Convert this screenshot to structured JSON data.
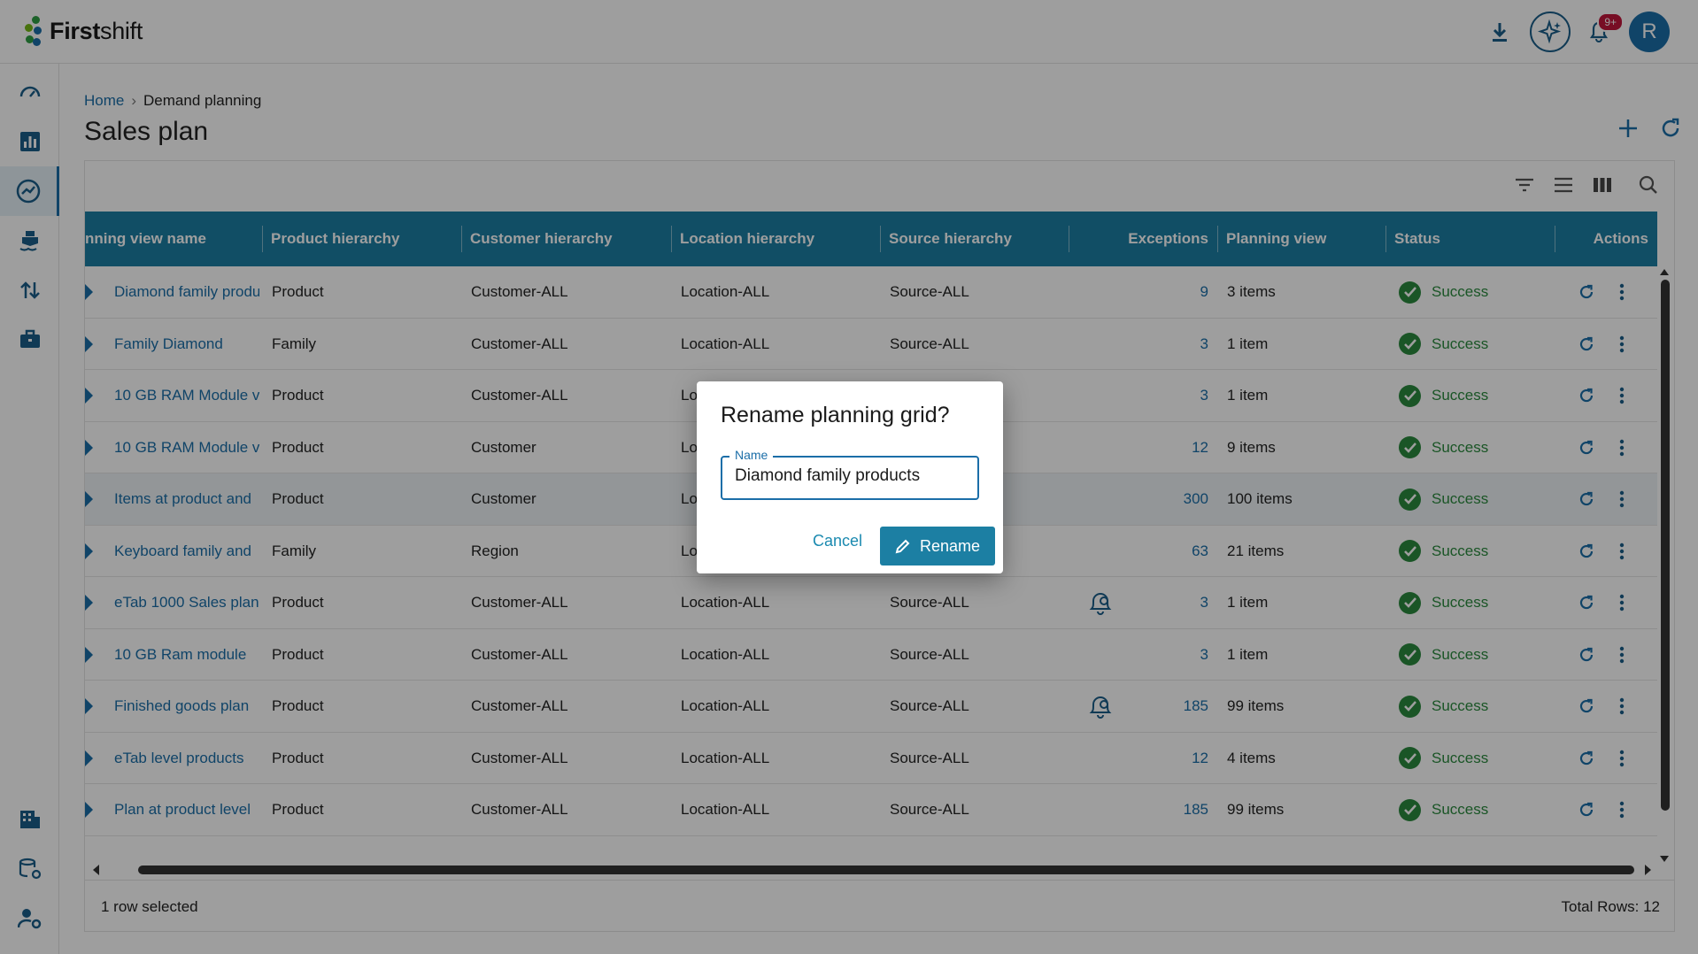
{
  "app": {
    "brand_bold": "First",
    "brand_rest": "shift"
  },
  "topbar": {
    "notification_badge": "9+",
    "avatar_initial": "R"
  },
  "breadcrumb": {
    "home": "Home",
    "current": "Demand planning"
  },
  "page": {
    "title": "Sales plan"
  },
  "grid": {
    "columns": {
      "name": "nning view name",
      "product": "Product hierarchy",
      "customer": "Customer hierarchy",
      "location": "Location hierarchy",
      "source": "Source hierarchy",
      "exceptions": "Exceptions",
      "planning_view": "Planning view",
      "status": "Status",
      "actions": "Actions"
    },
    "rows": [
      {
        "name": "Diamond family produ",
        "product": "Product",
        "customer": "Customer-ALL",
        "location": "Location-ALL",
        "source": "Source-ALL",
        "exceptions": "9",
        "planning_view": "3 items",
        "status": "Success"
      },
      {
        "name": "Family Diamond",
        "product": "Family",
        "customer": "Customer-ALL",
        "location": "Location-ALL",
        "source": "Source-ALL",
        "exceptions": "3",
        "planning_view": "1 item",
        "status": "Success"
      },
      {
        "name": "10 GB RAM Module v",
        "product": "Product",
        "customer": "Customer-ALL",
        "location": "Lo",
        "source": "",
        "exceptions": "3",
        "planning_view": "1 item",
        "status": "Success"
      },
      {
        "name": "10 GB RAM Module v",
        "product": "Product",
        "customer": "Customer",
        "location": "Lo",
        "source": "",
        "exceptions": "12",
        "planning_view": "9 items",
        "status": "Success"
      },
      {
        "name": "Items at product and",
        "product": "Product",
        "customer": "Customer",
        "location": "Lo",
        "source": "",
        "exceptions": "300",
        "planning_view": "100 items",
        "status": "Success"
      },
      {
        "name": "Keyboard family and",
        "product": "Family",
        "customer": "Region",
        "location": "Lo",
        "source": "",
        "exceptions": "63",
        "planning_view": "21 items",
        "status": "Success"
      },
      {
        "name": "eTab 1000 Sales plan",
        "product": "Product",
        "customer": "Customer-ALL",
        "location": "Location-ALL",
        "source": "Source-ALL",
        "exceptions": "3",
        "planning_view": "1 item",
        "status": "Success"
      },
      {
        "name": "10 GB Ram module",
        "product": "Product",
        "customer": "Customer-ALL",
        "location": "Location-ALL",
        "source": "Source-ALL",
        "exceptions": "3",
        "planning_view": "1 item",
        "status": "Success"
      },
      {
        "name": "Finished goods plan",
        "product": "Product",
        "customer": "Customer-ALL",
        "location": "Location-ALL",
        "source": "Source-ALL",
        "exceptions": "185",
        "planning_view": "99 items",
        "status": "Success"
      },
      {
        "name": "eTab level products",
        "product": "Product",
        "customer": "Customer-ALL",
        "location": "Location-ALL",
        "source": "Source-ALL",
        "exceptions": "12",
        "planning_view": "4 items",
        "status": "Success"
      },
      {
        "name": "Plan at product level",
        "product": "Product",
        "customer": "Customer-ALL",
        "location": "Location-ALL",
        "source": "Source-ALL",
        "exceptions": "185",
        "planning_view": "99 items",
        "status": "Success"
      }
    ],
    "footer": {
      "selected": "1 row selected",
      "total": "Total Rows: 12"
    }
  },
  "dialog": {
    "title": "Rename planning grid?",
    "field_label": "Name",
    "field_value": "Diamond family products",
    "cancel": "Cancel",
    "rename": "Rename"
  },
  "colors": {
    "accent": "#1c7fa3",
    "success": "#2b8a3e",
    "badge": "#c0163b"
  }
}
